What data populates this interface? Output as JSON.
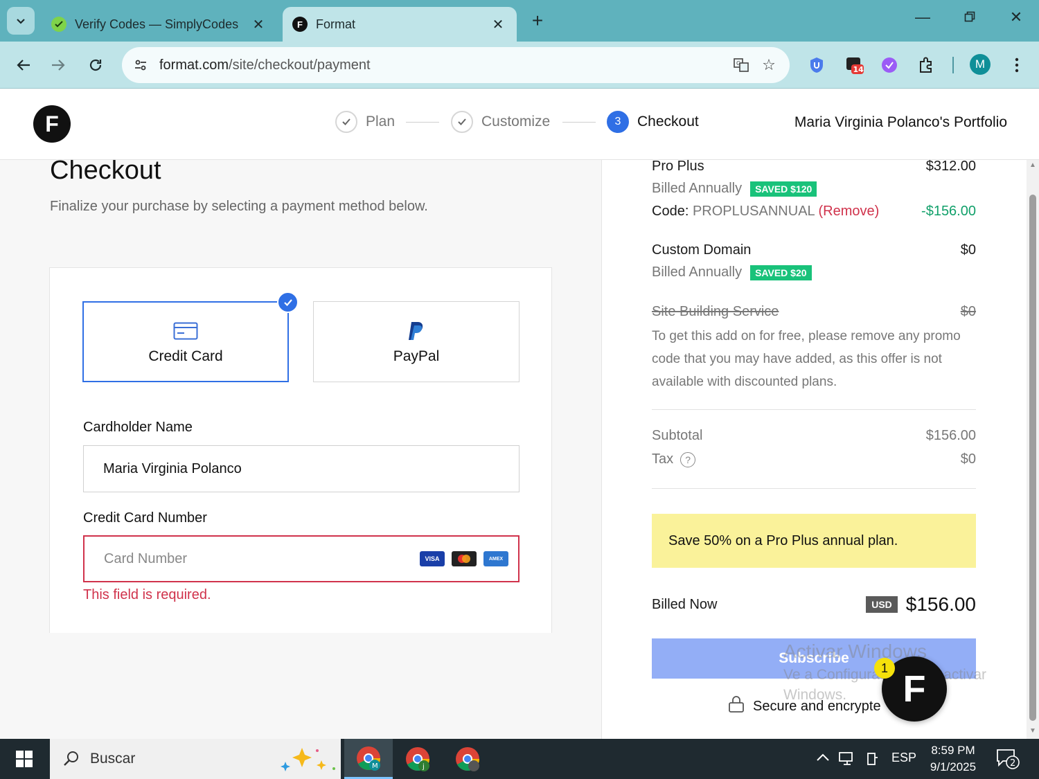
{
  "browser": {
    "tabs": [
      {
        "title": "Verify Codes — SimplyCodes",
        "active": false
      },
      {
        "title": "Format",
        "active": true
      }
    ],
    "url_host": "format.com",
    "url_path": "/site/checkout/payment",
    "extension_badge": "14",
    "profile_initial": "M"
  },
  "header": {
    "logo_letter": "F",
    "steps": [
      {
        "number": "",
        "label": "Plan",
        "state": "done"
      },
      {
        "number": "",
        "label": "Customize",
        "state": "done"
      },
      {
        "number": "3",
        "label": "Checkout",
        "state": "current"
      }
    ],
    "portfolio_name": "Maria Virginia Polanco's Portfolio"
  },
  "checkout": {
    "title": "Checkout",
    "subtitle": "Finalize your purchase by selecting a payment method below.",
    "methods": [
      {
        "label": "Credit Card",
        "selected": true
      },
      {
        "label": "PayPal",
        "selected": false
      }
    ],
    "cardholder_label": "Cardholder Name",
    "cardholder_value": "Maria Virginia Polanco",
    "card_number_label": "Credit Card Number",
    "card_number_placeholder": "Card Number",
    "card_brands": [
      "VISA",
      "MC",
      "AMEX"
    ],
    "error_text": "This field is required."
  },
  "summary": {
    "plan_name": "Pro Plus",
    "plan_price": "$312.00",
    "plan_billing": "Billed Annually",
    "plan_saved": "SAVED $120",
    "code_label": "Code:",
    "code_value": "PROPLUSANNUAL",
    "code_remove": "(Remove)",
    "code_discount": "-$156.00",
    "domain_name": "Custom Domain",
    "domain_price": "$0",
    "domain_billing": "Billed Annually",
    "domain_saved": "SAVED $20",
    "service_name": "Site Building Service",
    "service_price": "$0",
    "service_note": "To get this add on for free, please remove any promo code that you may have added, as this offer is not available with discounted plans.",
    "subtotal_label": "Subtotal",
    "subtotal_value": "$156.00",
    "tax_label": "Tax",
    "tax_value": "$0",
    "promo_text": "Save 50% on a Pro Plus annual plan.",
    "billed_now_label": "Billed Now",
    "currency": "USD",
    "billed_now_value": "$156.00",
    "subscribe_label": "Subscribe",
    "secure_text": "Secure and encrypte",
    "watermark_title": "Activar Windows",
    "watermark_line1": "Ve a Configuración para activar",
    "watermark_line2": "Windows.",
    "chat_letter": "F",
    "chat_count": "1"
  },
  "taskbar": {
    "search_label": "Buscar",
    "language": "ESP",
    "time": "8:59 PM",
    "date": "9/1/2025",
    "notification_count": "2"
  },
  "colors": {
    "accent_blue": "#2f6fe5",
    "error_red": "#d0324b",
    "saved_green": "#19c27a",
    "promo_yellow": "#faf29a",
    "subscribe_disabled": "#93aef6"
  }
}
